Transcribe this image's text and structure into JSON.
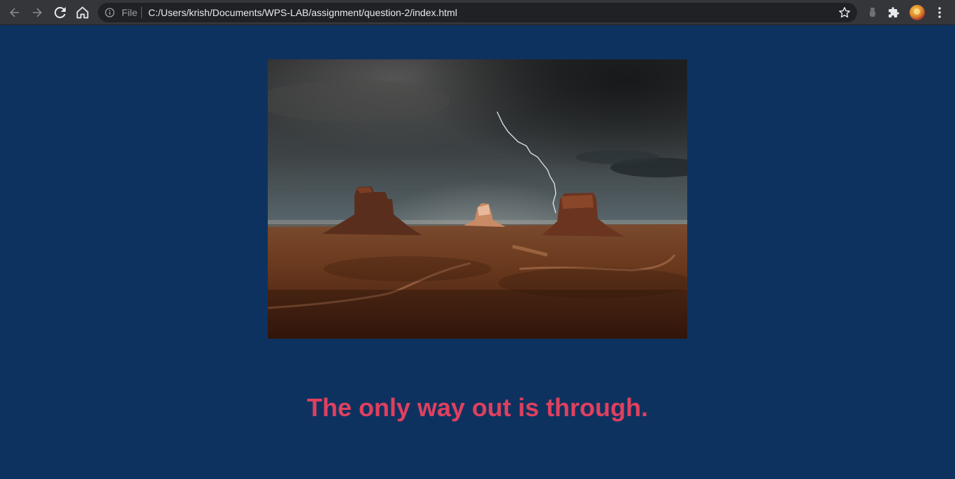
{
  "browser": {
    "scheme_label": "File",
    "url": "C:/Users/krish/Documents/WPS-LAB/assignment/question-2/index.html",
    "icons": {
      "back": "arrow-left-icon",
      "forward": "arrow-right-icon",
      "reload": "reload-icon",
      "home": "home-icon",
      "site_info": "info-icon",
      "bookmark": "star-icon",
      "extension": "extension-icon",
      "extensions_menu": "puzzle-icon",
      "profile": "avatar",
      "menu": "kebab-menu-icon"
    }
  },
  "page": {
    "background_color": "#0e3260",
    "image_subject": "desert mesas under stormy sky with lightning",
    "quote": "The only way out is through.",
    "quote_color": "#e0405e"
  }
}
